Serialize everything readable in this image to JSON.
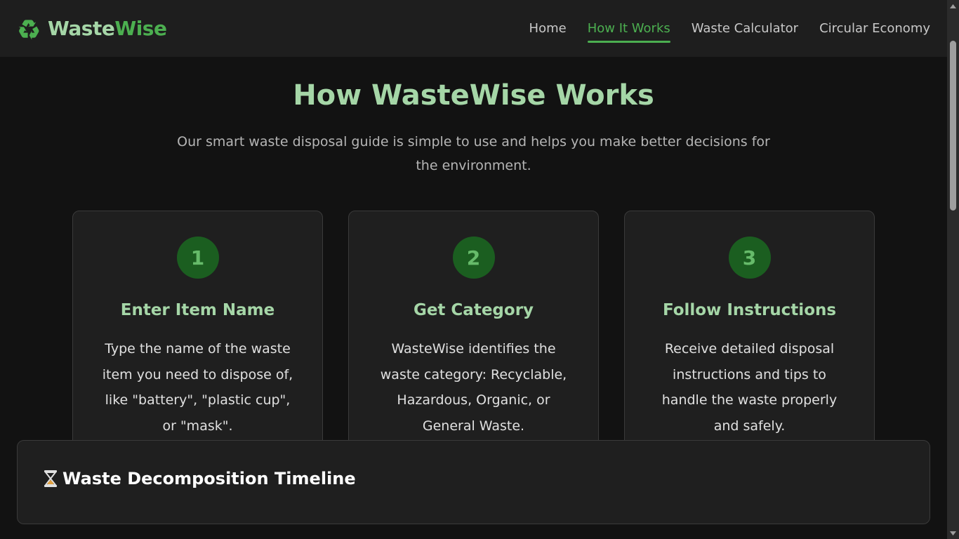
{
  "brand": {
    "part1": "Waste",
    "part2": "Wise",
    "logo_icon": "recycle-icon"
  },
  "nav": {
    "items": [
      {
        "label": "Home",
        "active": false
      },
      {
        "label": "How It Works",
        "active": true
      },
      {
        "label": "Waste Calculator",
        "active": false
      },
      {
        "label": "Circular Economy",
        "active": false
      }
    ]
  },
  "main": {
    "title": "How WasteWise Works",
    "subtitle": "Our smart waste disposal guide is simple to use and helps you make better decisions for the environment.",
    "steps": [
      {
        "number": "1",
        "title": "Enter Item Name",
        "description": "Type the name of the waste item you need to dispose of, like \"battery\", \"plastic cup\", or \"mask\"."
      },
      {
        "number": "2",
        "title": "Get Category",
        "description": "WasteWise identifies the waste category: Recyclable, Hazardous, Organic, or General Waste."
      },
      {
        "number": "3",
        "title": "Follow Instructions",
        "description": "Receive detailed disposal instructions and tips to handle the waste properly and safely."
      }
    ]
  },
  "timeline": {
    "title": "Waste Decomposition Timeline",
    "icon": "hourglass-icon"
  },
  "colors": {
    "accent": "#4caf50",
    "accent_light": "#a5d6a7",
    "step_circle": "#1b5e20",
    "background": "#121212",
    "card": "#1f1f1f"
  }
}
